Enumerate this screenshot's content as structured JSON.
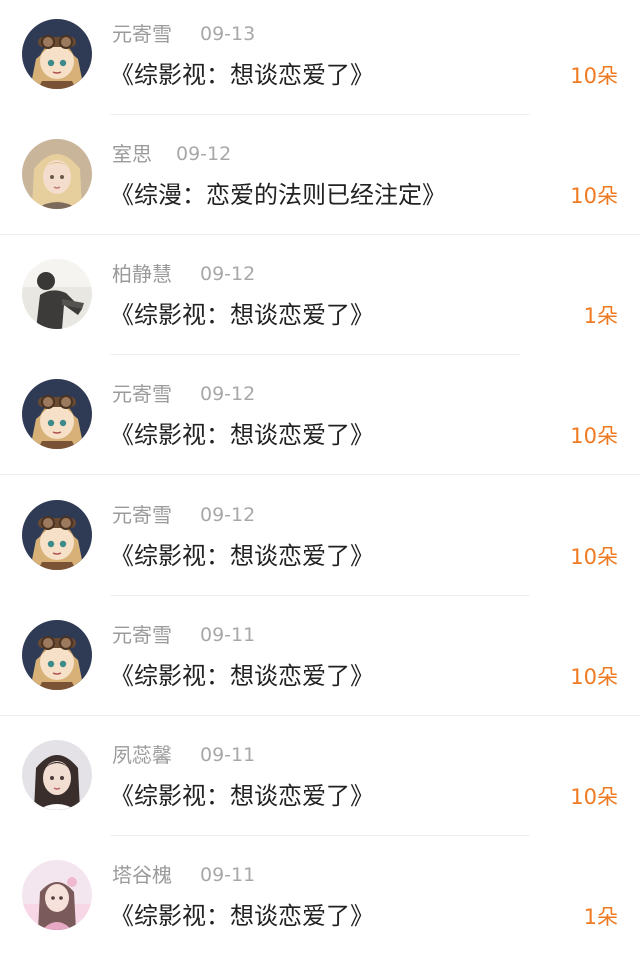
{
  "items": [
    {
      "user": "元寄雪",
      "date": "09-13",
      "title": "《综影视：想谈恋爱了》",
      "gift": "10朵",
      "avatar": "anime-goggles-avatar"
    },
    {
      "user": "室思",
      "date": "09-12",
      "title": "《综漫：恋爱的法则已经注定》",
      "gift": "10朵",
      "avatar": "blonde-girl-avatar"
    },
    {
      "user": "柏静慧",
      "date": "09-12",
      "title": "《综影视：想谈恋爱了》",
      "gift": "1朵",
      "avatar": "person-photo-avatar"
    },
    {
      "user": "元寄雪",
      "date": "09-12",
      "title": "《综影视：想谈恋爱了》",
      "gift": "10朵",
      "avatar": "anime-goggles-avatar"
    },
    {
      "user": "元寄雪",
      "date": "09-12",
      "title": "《综影视：想谈恋爱了》",
      "gift": "10朵",
      "avatar": "anime-goggles-avatar"
    },
    {
      "user": "元寄雪",
      "date": "09-11",
      "title": "《综影视：想谈恋爱了》",
      "gift": "10朵",
      "avatar": "anime-goggles-avatar"
    },
    {
      "user": "夙蕊馨",
      "date": "09-11",
      "title": "《综影视：想谈恋爱了》",
      "gift": "10朵",
      "avatar": "woman-portrait-avatar"
    },
    {
      "user": "塔谷槐",
      "date": "09-11",
      "title": "《综影视：想谈恋爱了》",
      "gift": "1朵",
      "avatar": "pink-girl-avatar"
    }
  ],
  "colors": {
    "gift": "#f07a22",
    "username": "#9b9b9b",
    "date": "#a8a8a8",
    "title": "#222222",
    "divider": "#efefef"
  }
}
